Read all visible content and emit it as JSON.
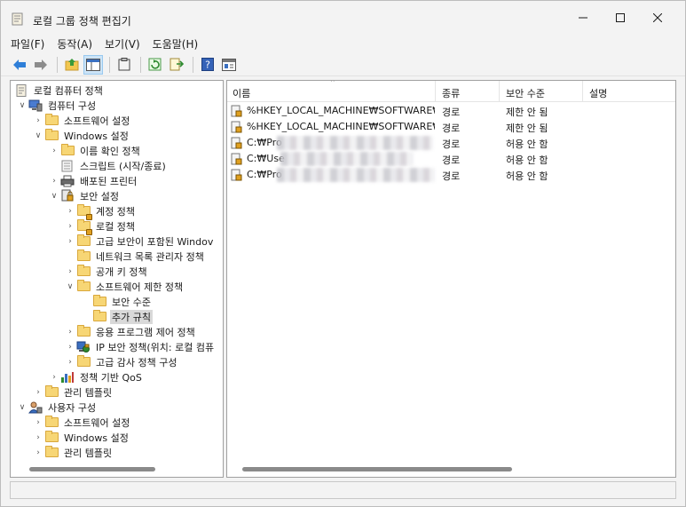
{
  "window": {
    "title": "로컬 그룹 정책 편집기"
  },
  "menu": [
    {
      "label": "파일(F)"
    },
    {
      "label": "동작(A)"
    },
    {
      "label": "보기(V)"
    },
    {
      "label": "도움말(H)"
    }
  ],
  "toolbar": {
    "icons": [
      "back-arrow-icon",
      "forward-arrow-icon",
      "up-folder-icon",
      "show-hide-tree-icon",
      "clipboard-icon",
      "refresh-icon",
      "export-list-icon",
      "help-icon",
      "properties-icon"
    ]
  },
  "tree": {
    "root": "로컬 컴퓨터 정책",
    "computer_config": "컴퓨터 구성",
    "software_settings": "소프트웨어 설정",
    "windows_settings": "Windows 설정",
    "name_resolution": "이름 확인 정책",
    "scripts": "스크립트 (시작/종료)",
    "deployed_printers": "배포된 프린터",
    "security_settings": "보안 설정",
    "account_policies": "계정 정책",
    "local_policies": "로컬 정책",
    "advanced_firewall": "고급 보안이 포함된 Windov",
    "network_list": "네트워크 목록 관리자 정책",
    "public_key": "공개 키 정책",
    "software_restriction": "소프트웨어 제한 정책",
    "security_levels": "보안 수준",
    "additional_rules": "추가 규칙",
    "app_control": "응용 프로그램 제어 정책",
    "ip_security": "IP 보안 정책(위치: 로컬 컴퓨",
    "advanced_audit": "고급 감사 정책 구성",
    "qos": "정책 기반 QoS",
    "admin_templates": "관리 템플릿",
    "user_config": "사용자 구성",
    "user_software_settings": "소프트웨어 설정",
    "user_windows_settings": "Windows 설정",
    "user_admin_templates": "관리 템플릿"
  },
  "list": {
    "columns": [
      "이름",
      "종류",
      "보안 수준",
      "설명"
    ],
    "rows": [
      {
        "name": "%HKEY_LOCAL_MACHINE₩SOFTWARE₩...",
        "type": "경로",
        "level": "제한 안 됨",
        "desc": ""
      },
      {
        "name": "%HKEY_LOCAL_MACHINE₩SOFTWARE₩...",
        "type": "경로",
        "level": "제한 안 됨",
        "desc": ""
      },
      {
        "name": "C:₩Pro",
        "type": "경로",
        "level": "허용 안 함",
        "desc": ""
      },
      {
        "name": "C:₩Use",
        "type": "경로",
        "level": "허용 안 함",
        "desc": ""
      },
      {
        "name": "C:₩Pro",
        "type": "경로",
        "level": "허용 안 함",
        "desc": ""
      }
    ]
  }
}
